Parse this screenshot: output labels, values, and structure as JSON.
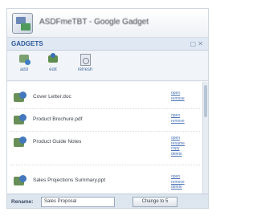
{
  "window": {
    "title": "ASDFmeTBT - Google Gadget"
  },
  "section": {
    "label": "GADGETS",
    "controls": "▢ ✕"
  },
  "toolbar": {
    "buttons": [
      {
        "label": "add",
        "icon": "add-icon"
      },
      {
        "label": "edit",
        "icon": "edit-icon"
      },
      {
        "label": "refresh",
        "icon": "refresh-icon"
      }
    ]
  },
  "list": {
    "items": [
      {
        "title": "Cover Letter.doc",
        "links": [
          "open",
          "remove"
        ]
      },
      {
        "title": "Product Brochure.pdf",
        "links": [
          "open",
          "remove"
        ]
      },
      {
        "title": "Product Guide Notes",
        "links": [
          "open",
          "rename",
          "copy",
          "delete"
        ]
      },
      {
        "title": "Sales Projections Summary.ppt",
        "links": [
          "open",
          "remove",
          "delete"
        ]
      }
    ]
  },
  "footer": {
    "label": "Rename:",
    "input_value": "Sales Proposal",
    "button_label": "Change to 5"
  }
}
